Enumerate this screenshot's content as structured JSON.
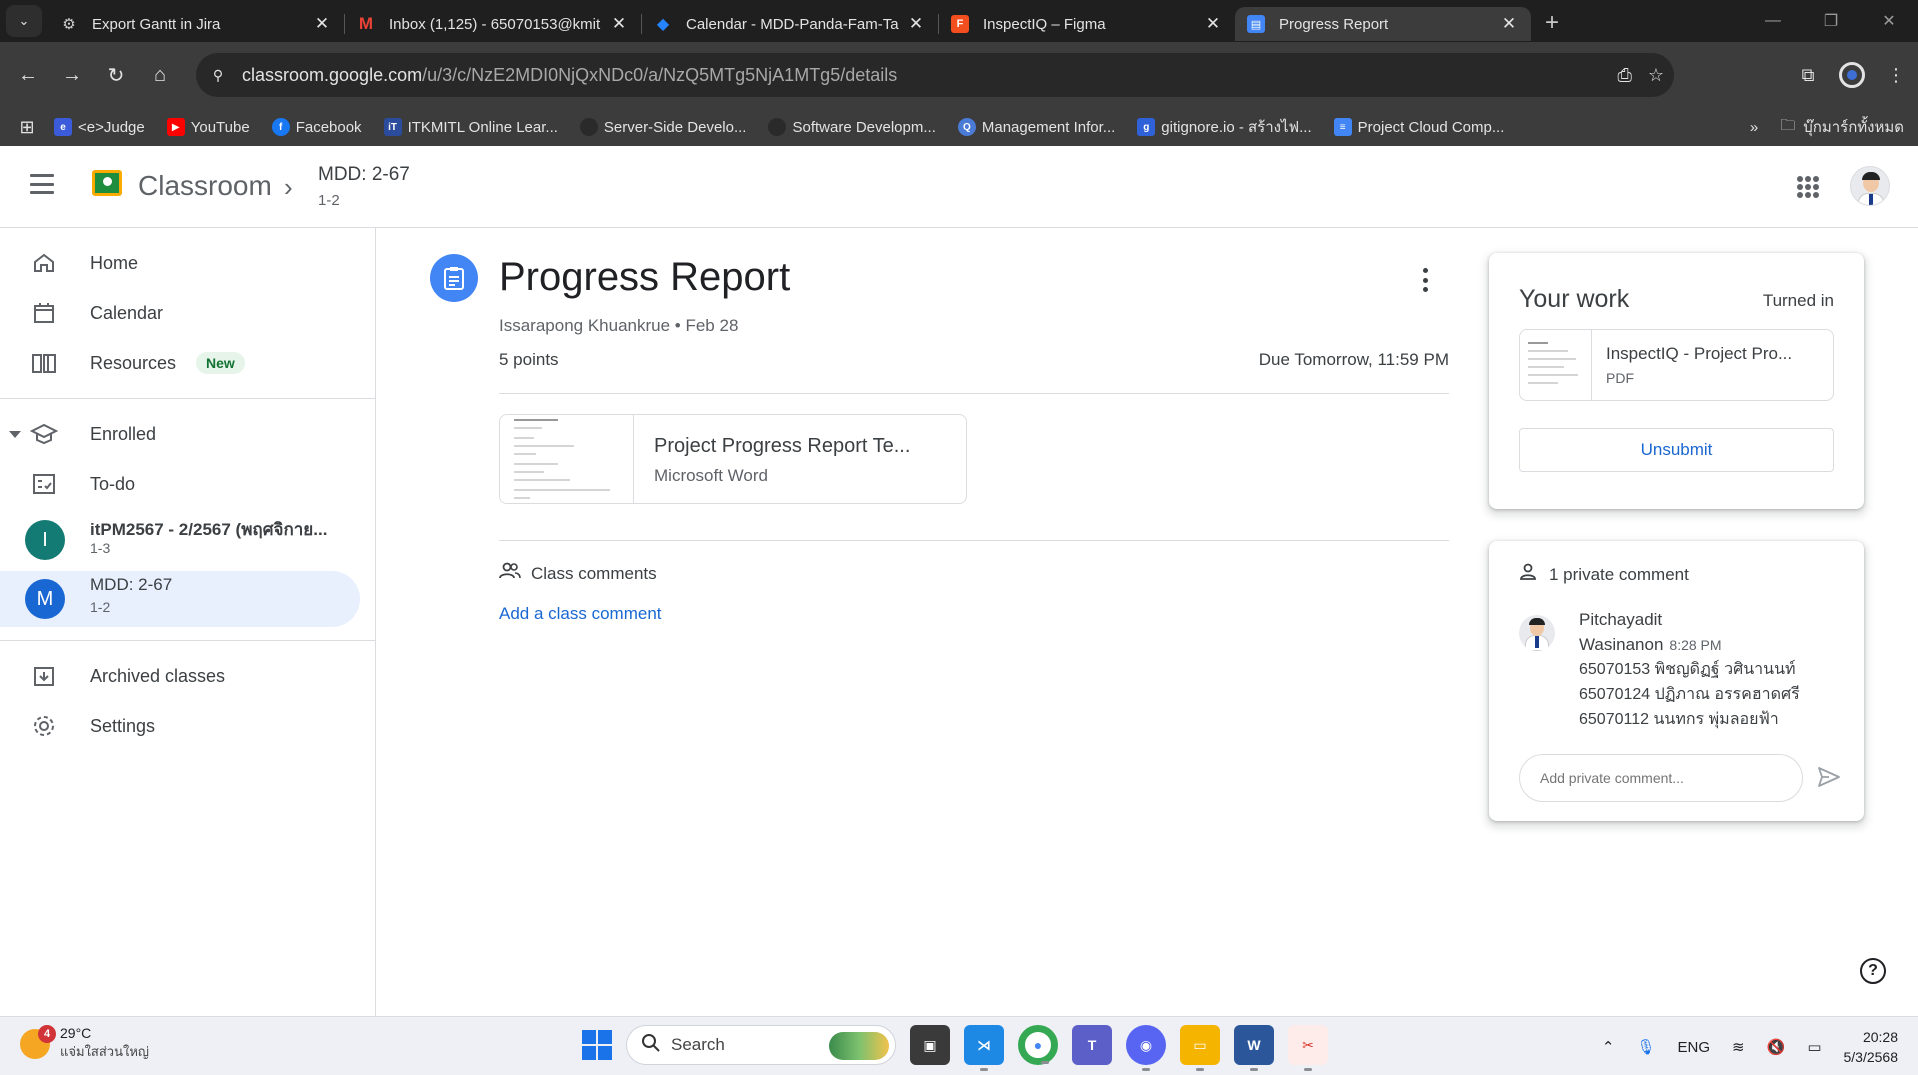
{
  "browser": {
    "tabs": [
      {
        "title": "Export Gantt in Jira",
        "active": false
      },
      {
        "title": "Inbox (1,125) - 65070153@kmit",
        "active": false
      },
      {
        "title": "Calendar - MDD-Panda-Fam-Ta",
        "active": false
      },
      {
        "title": "InspectIQ – Figma",
        "active": false
      },
      {
        "title": "Progress Report",
        "active": true
      }
    ],
    "url_host": "classroom.google.com",
    "url_path": "/u/3/c/NzE2MDI0NjQxNDc0/a/NzQ5MTg5NjA1MTg5/details",
    "bookmarks": [
      "<e>Judge",
      "YouTube",
      "Facebook",
      "ITKMITL Online Lear...",
      "Server-Side Develo...",
      "Software Developm...",
      "Management Infor...",
      "gitignore.io - สร้างไฟ...",
      "Project Cloud Comp..."
    ],
    "bookmarks_folder": "บุ๊กมาร์กทั้งหมด"
  },
  "header": {
    "app_name": "Classroom",
    "class_name": "MDD: 2-67",
    "class_section": "1-2"
  },
  "sidebar": {
    "home": "Home",
    "calendar": "Calendar",
    "resources": "Resources",
    "resources_badge": "New",
    "enrolled": "Enrolled",
    "todo": "To-do",
    "classes": [
      {
        "initial": "I",
        "name": "itPM2567 - 2/2567 (พฤศจิกาย...",
        "section": "1-3",
        "color": "#137b73"
      },
      {
        "initial": "M",
        "name": "MDD: 2-67",
        "section": "1-2",
        "color": "#1967d2"
      }
    ],
    "archived": "Archived classes",
    "settings": "Settings"
  },
  "assignment": {
    "title": "Progress Report",
    "author": "Issarapong Khuankrue",
    "date": "Feb 28",
    "points": "5 points",
    "due": "Due Tomorrow, 11:59 PM",
    "attachment_name": "Project Progress Report Te...",
    "attachment_type": "Microsoft Word",
    "comments_heading": "Class comments",
    "add_comment": "Add a class comment"
  },
  "your_work": {
    "title": "Your work",
    "status": "Turned in",
    "file_name": "InspectIQ - Project Pro...",
    "file_type": "PDF",
    "unsubmit": "Unsubmit"
  },
  "private_comments": {
    "heading": "1 private comment",
    "author_first": "Pitchayadit",
    "author_last": "Wasinanon",
    "time": "8:28 PM",
    "lines": [
      "65070153 พิชญดิฏฐ์ วศินานนท์",
      "65070124 ปฏิภาณ อรรคฮาดศรี",
      "65070112 นนทกร พุ่มลอยฟ้า"
    ],
    "placeholder": "Add private comment..."
  },
  "taskbar": {
    "weather_badge": "4",
    "temp": "29°C",
    "weather_desc": "แจ่มใสส่วนใหญ่",
    "search": "Search",
    "lang": "ENG",
    "time": "20:28",
    "date": "5/3/2568"
  }
}
